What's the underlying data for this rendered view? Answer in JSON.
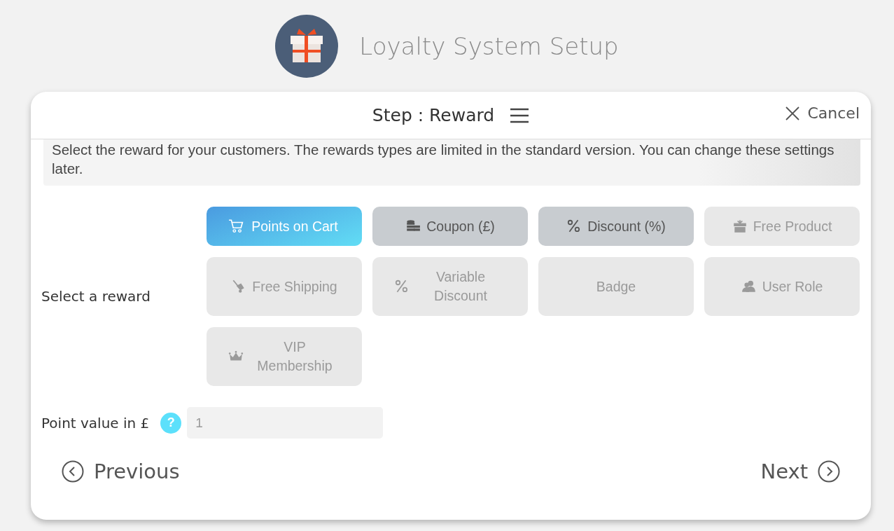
{
  "app": {
    "title": "Loyalty System Setup"
  },
  "step": {
    "title": "Step : Reward",
    "cancel": "Cancel"
  },
  "description": "Select the reward for your customers. The rewards types are limited in the standard version. You can change these settings later.",
  "reward_label": "Select a reward",
  "rewards": [
    {
      "label": "Points on Cart",
      "selected": true,
      "disabled": false
    },
    {
      "label": "Coupon (£)",
      "selected": false,
      "disabled": false
    },
    {
      "label": "Discount (%)",
      "selected": false,
      "disabled": false
    },
    {
      "label": "Free Product",
      "selected": false,
      "disabled": true
    },
    {
      "label": "Free Shipping",
      "selected": false,
      "disabled": true
    },
    {
      "label": "Variable Discount",
      "selected": false,
      "disabled": true
    },
    {
      "label": "Badge",
      "selected": false,
      "disabled": true
    },
    {
      "label": "User Role",
      "selected": false,
      "disabled": true
    },
    {
      "label": "VIP Membership",
      "selected": false,
      "disabled": true
    }
  ],
  "point_value": {
    "label": "Point value in £",
    "help": "?",
    "placeholder": "1"
  },
  "nav": {
    "previous": "Previous",
    "next": "Next"
  }
}
